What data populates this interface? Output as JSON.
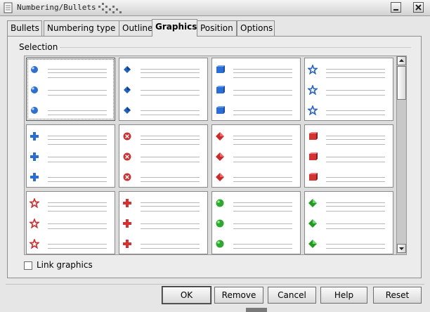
{
  "window": {
    "title": "Numbering/Bullets"
  },
  "tabs": [
    {
      "label": "Bullets",
      "active": false
    },
    {
      "label": "Numbering type",
      "active": false
    },
    {
      "label": "Outline",
      "active": false
    },
    {
      "label": "Graphics",
      "active": true
    },
    {
      "label": "Position",
      "active": false
    },
    {
      "label": "Options",
      "active": false
    }
  ],
  "selection": {
    "label": "Selection",
    "bullets": [
      {
        "icon": "blue-sphere-icon",
        "color": "#2f6fcf"
      },
      {
        "icon": "blue-diamond-arrow-icon",
        "color": "#1f62b8"
      },
      {
        "icon": "blue-cube-icon",
        "color": "#2b6dd2"
      },
      {
        "icon": "blue-star-icon",
        "color": "#2a64c0"
      },
      {
        "icon": "blue-arrow-cross-icon",
        "color": "#2a6fd0"
      },
      {
        "icon": "red-x-sphere-icon",
        "color": "#c83232"
      },
      {
        "icon": "red-diamond-icon",
        "color": "#c82a2a"
      },
      {
        "icon": "red-cube-icon",
        "color": "#d23434"
      },
      {
        "icon": "red-star-icon",
        "color": "#cc2e2e"
      },
      {
        "icon": "red-arrow-cross-icon",
        "color": "#d83030"
      },
      {
        "icon": "green-sphere-icon",
        "color": "#2ea82e"
      },
      {
        "icon": "green-diamond-icon",
        "color": "#239b23"
      }
    ]
  },
  "options": {
    "link_graphics_label": "Link graphics",
    "link_graphics_checked": false
  },
  "buttons": {
    "ok": "OK",
    "remove": "Remove",
    "cancel": "Cancel",
    "help": "Help",
    "reset": "Reset"
  }
}
